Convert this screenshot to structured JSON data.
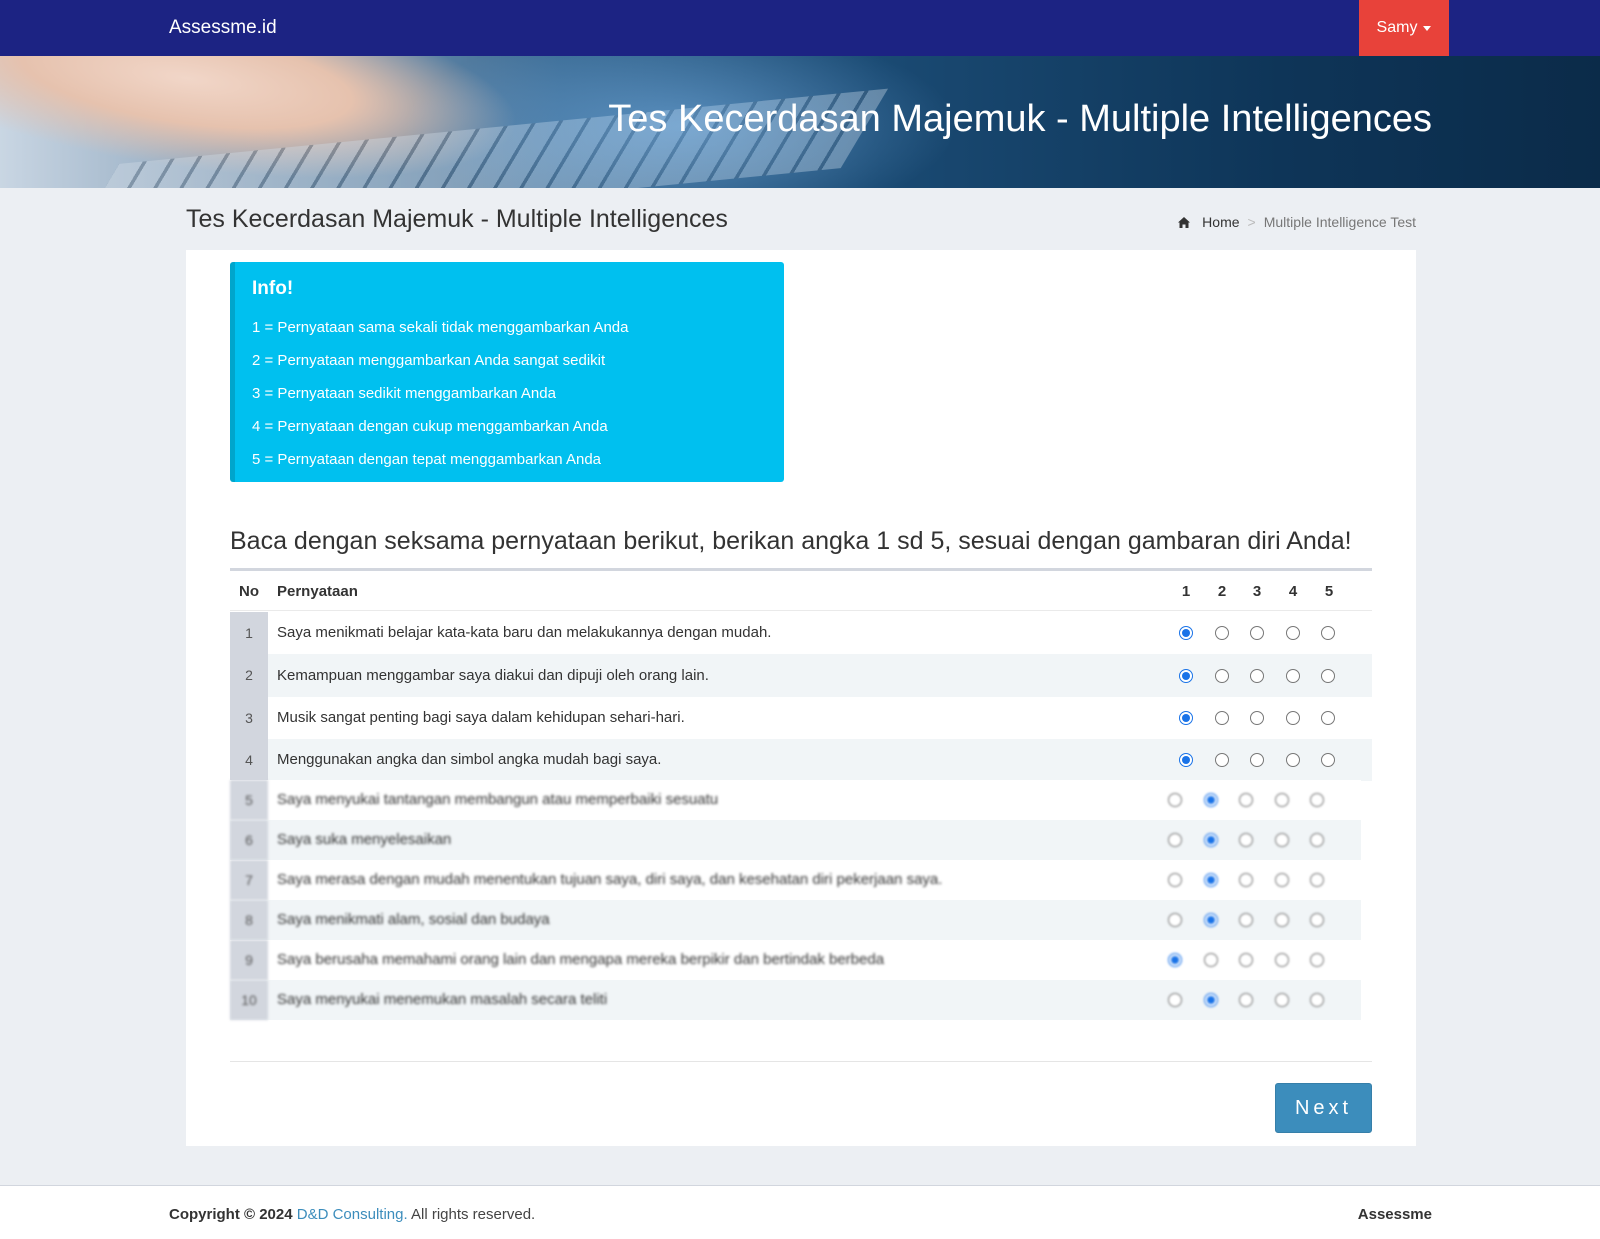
{
  "navbar": {
    "brand": "Assessme.id",
    "user": "Samy"
  },
  "banner": {
    "title": "Tes Kecerdasan Majemuk - Multiple Intelligences"
  },
  "page": {
    "title": "Tes Kecerdasan Majemuk - Multiple Intelligences",
    "breadcrumb": {
      "home": "Home",
      "separator": ">",
      "current": "Multiple Intelligence Test"
    }
  },
  "info": {
    "title": "Info!",
    "lines": [
      "1 = Pernyataan sama sekali tidak menggambarkan Anda",
      "2 = Pernyataan menggambarkan Anda sangat sedikit",
      "3 = Pernyataan sedikit menggambarkan Anda",
      "4 = Pernyataan dengan cukup menggambarkan Anda",
      "5 = Pernyataan dengan tepat menggambarkan Anda"
    ]
  },
  "instruction": "Baca dengan seksama pernyataan berikut, berikan angka 1 sd 5, sesuai dengan gambaran diri Anda!",
  "table": {
    "headers": {
      "no": "No",
      "statement": "Pernyataan",
      "options": [
        "1",
        "2",
        "3",
        "4",
        "5"
      ]
    },
    "rows": [
      {
        "no": "1",
        "text": "Saya menikmati belajar kata-kata baru dan melakukannya dengan mudah.",
        "selected": 1
      },
      {
        "no": "2",
        "text": "Kemampuan menggambar saya diakui dan dipuji oleh orang lain.",
        "selected": 1
      },
      {
        "no": "3",
        "text": "Musik sangat penting bagi saya dalam kehidupan sehari-hari.",
        "selected": 1
      },
      {
        "no": "4",
        "text": "Menggunakan angka dan simbol angka mudah bagi saya.",
        "selected": 1
      },
      {
        "no": "5",
        "text": "Saya menyukai tantangan membangun atau memperbaiki sesuatu",
        "selected": 2
      },
      {
        "no": "6",
        "text": "Saya suka menyelesaikan",
        "selected": 2
      },
      {
        "no": "7",
        "text": "Saya merasa dengan mudah menentukan tujuan saya, diri saya, dan kesehatan diri pekerjaan saya.",
        "selected": 2
      },
      {
        "no": "8",
        "text": "Saya menikmati alam, sosial dan budaya",
        "selected": 2
      },
      {
        "no": "9",
        "text": "Saya berusaha memahami orang lain dan mengapa mereka berpikir dan bertindak berbeda",
        "selected": 1
      },
      {
        "no": "10",
        "text": "Saya menyukai menemukan masalah secara teliti",
        "selected": 2
      }
    ]
  },
  "actions": {
    "next": "Next"
  },
  "footer": {
    "copyright_prefix": "Copyright © 2024",
    "company": "D&D Consulting.",
    "rights": "All rights reserved.",
    "brand": "Assessme"
  },
  "colors": {
    "navbar": "#1c2383",
    "user_menu": "#e8423a",
    "info_box": "#00c0ef",
    "primary_button": "#3c8dbc",
    "radio_checked": "#1a73e8"
  },
  "icons": {
    "breadcrumb_home": "home-icon",
    "user_menu": "caret-down-icon"
  }
}
